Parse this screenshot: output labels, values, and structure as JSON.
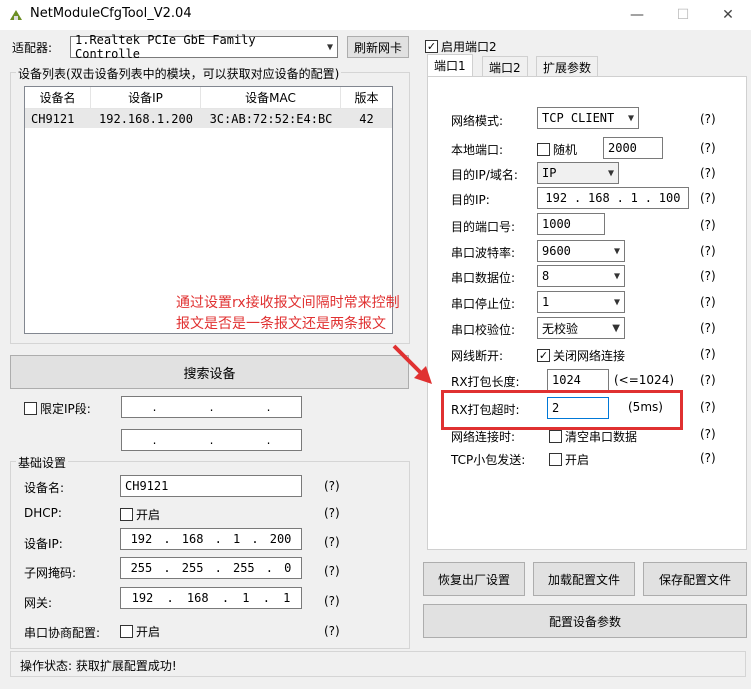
{
  "window": {
    "title": "NetModuleCfgTool_V2.04"
  },
  "adapter": {
    "label": "适配器:",
    "value": "1.Realtek PCIe GbE Family Controlle",
    "refresh": "刷新网卡"
  },
  "devices": {
    "label": "设备列表(双击设备列表中的模块，可以获取对应设备的配置)",
    "columns": [
      "设备名",
      "设备IP",
      "设备MAC",
      "版本"
    ],
    "rows": [
      [
        "CH9121",
        "192.168.1.200",
        "3C:AB:72:52:E4:BC",
        "42"
      ]
    ]
  },
  "search": {
    "button": "搜索设备",
    "limit_ip": "限定IP段:"
  },
  "basic": {
    "label": "基础设置",
    "name_label": "设备名:",
    "name_value": "CH9121",
    "dhcp_label": "DHCP:",
    "dhcp_option": "开启",
    "ip_label": "设备IP:",
    "ip": [
      "192",
      "168",
      "1",
      "200"
    ],
    "mask_label": "子网掩码:",
    "mask": [
      "255",
      "255",
      "255",
      "0"
    ],
    "gw_label": "网关:",
    "gw": [
      "192",
      "168",
      "1",
      "1"
    ],
    "serial_label": "串口协商配置:",
    "serial_option": "开启",
    "help": "(?)"
  },
  "status": {
    "text": "操作状态: 获取扩展配置成功!"
  },
  "port2": {
    "enable_label": "启用端口2"
  },
  "tabs": [
    "端口1",
    "端口2",
    "扩展参数"
  ],
  "port": {
    "mode_label": "网络模式:",
    "mode_value": "TCP CLIENT",
    "local_port_label": "本地端口:",
    "random_label": "随机",
    "local_port_value": "2000",
    "dest_type_label": "目的IP/域名:",
    "dest_type_value": "IP",
    "dest_ip_label": "目的IP:",
    "dest_ip": [
      "192",
      "168",
      "1",
      "100"
    ],
    "dest_port_label": "目的端口号:",
    "dest_port_value": "1000",
    "baud_label": "串口波特率:",
    "baud_value": "9600",
    "databits_label": "串口数据位:",
    "databits_value": "8",
    "stopbits_label": "串口停止位:",
    "stopbits_value": "1",
    "parity_label": "串口校验位:",
    "parity_value": "无校验",
    "disconnect_label": "网线断开:",
    "disconnect_option": "关闭网络连接",
    "rx_len_label": "RX打包长度:",
    "rx_len_value": "1024",
    "rx_len_hint": "(<=1024)",
    "rx_timeout_label": "RX打包超时:",
    "rx_timeout_value": "2",
    "rx_timeout_hint": "(5ms)",
    "net_conn_label": "网络连接时:",
    "net_conn_option": "清空串口数据",
    "tcp_small_label": "TCP小包发送:",
    "tcp_small_option": "开启",
    "help": "(?)"
  },
  "actions": {
    "factory": "恢复出厂设置",
    "load": "加载配置文件",
    "save": "保存配置文件",
    "configure": "配置设备参数"
  },
  "annotation": {
    "line1": "通过设置rx接收报文间隔时常来控制",
    "line2": "报文是否是一条报文还是两条报文"
  },
  "colors": {
    "annotation": "#e03131"
  }
}
